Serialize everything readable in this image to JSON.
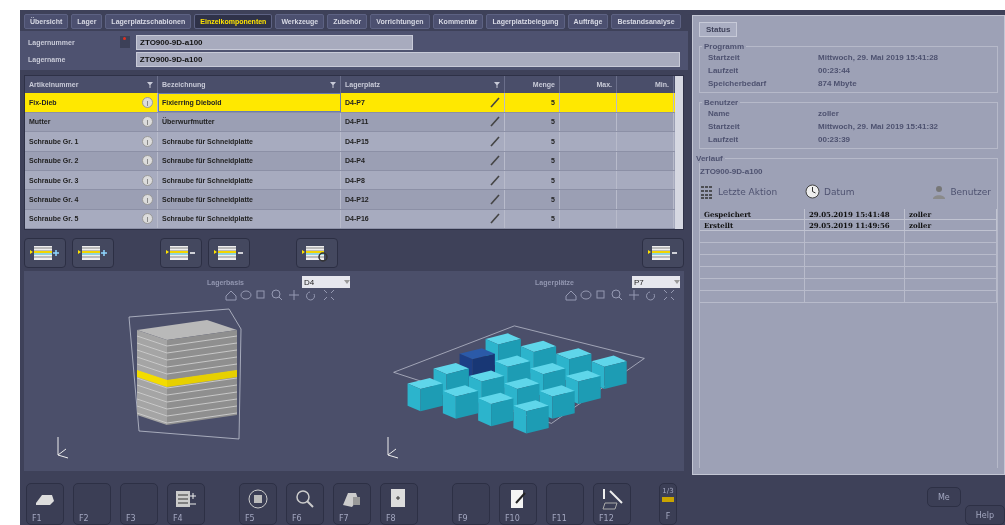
{
  "tabs": [
    {
      "label": "Übersicht",
      "selected": false
    },
    {
      "label": "Lager",
      "selected": false
    },
    {
      "label": "Lagerplatzschablonen",
      "selected": false
    },
    {
      "label": "Einzelkomponenten",
      "selected": true
    },
    {
      "label": "Werkzeuge",
      "selected": false
    },
    {
      "label": "Zubehör",
      "selected": false
    },
    {
      "label": "Vorrichtungen",
      "selected": false
    },
    {
      "label": "Kommentar",
      "selected": false
    },
    {
      "label": "Lagerplatzbelegung",
      "selected": false
    },
    {
      "label": "Aufträge",
      "selected": false
    },
    {
      "label": "Bestandsanalyse",
      "selected": false
    }
  ],
  "fields": [
    {
      "label": "Lagernummer",
      "value": "ZTO900-9D-a100",
      "required": true
    },
    {
      "label": "Lagername",
      "value": "ZTO900-9D-a100",
      "required": false
    }
  ],
  "table": {
    "columns": [
      {
        "label": "Artikelnummer",
        "filter": true
      },
      {
        "label": "Bezeichnung",
        "filter": true
      },
      {
        "label": "Lagerplatz",
        "filter": true
      },
      {
        "label": "Menge",
        "filter": false
      },
      {
        "label": "Max.",
        "filter": false
      },
      {
        "label": "Min.",
        "filter": false
      }
    ],
    "rows": [
      {
        "artikelnummer": "Fix-Dieb",
        "bezeichnung": "Fixierring Diebold",
        "lagerplatz": "D4-P7",
        "menge": "5",
        "selected": true
      },
      {
        "artikelnummer": "Mutter",
        "bezeichnung": "Überwurfmutter",
        "lagerplatz": "D4-P11",
        "menge": "5",
        "selected": false
      },
      {
        "artikelnummer": "Schraube Gr. 1",
        "bezeichnung": "Schraube für Schneidplatte",
        "lagerplatz": "D4-P15",
        "menge": "5",
        "selected": false
      },
      {
        "artikelnummer": "Schraube Gr. 2",
        "bezeichnung": "Schraube für Schneidplatte",
        "lagerplatz": "D4-P4",
        "menge": "5",
        "selected": false
      },
      {
        "artikelnummer": "Schraube Gr. 3",
        "bezeichnung": "Schraube für Schneidplatte",
        "lagerplatz": "D4-P8",
        "menge": "5",
        "selected": false
      },
      {
        "artikelnummer": "Schraube Gr. 4",
        "bezeichnung": "Schraube für Schneidplatte",
        "lagerplatz": "D4-P12",
        "menge": "5",
        "selected": false
      },
      {
        "artikelnummer": "Schraube Gr. 5",
        "bezeichnung": "Schraube für Schneidplatte",
        "lagerplatz": "D4-P16",
        "menge": "5",
        "selected": false
      }
    ]
  },
  "table_toolbar": [
    {
      "kind": "add"
    },
    {
      "kind": "add"
    },
    {
      "kind": "gap"
    },
    {
      "kind": "remove"
    },
    {
      "kind": "remove"
    },
    {
      "kind": "gap"
    },
    {
      "kind": "search"
    },
    {
      "kind": "spacer"
    },
    {
      "kind": "remove"
    }
  ],
  "viewers": [
    {
      "title": "Lagerbasis",
      "selector": "D4",
      "kind": "stack"
    },
    {
      "title": "Lagerplätze",
      "selector": "P7",
      "kind": "grid"
    }
  ],
  "status": {
    "tab": "Status",
    "sections": [
      {
        "title": "Programm",
        "rows": [
          {
            "label": "Startzeit",
            "value": "Mittwoch, 29. Mai 2019 15:41:28"
          },
          {
            "label": "Laufzeit",
            "value": "00:23:44"
          },
          {
            "label": "Speicherbedarf",
            "value": "874 Mbyte"
          }
        ]
      },
      {
        "title": "Benutzer",
        "rows": [
          {
            "label": "Name",
            "value": "zoller"
          },
          {
            "label": "Startzeit",
            "value": "Mittwoch, 29. Mai 2019 15:41:32"
          },
          {
            "label": "Laufzeit",
            "value": "00:23:39"
          }
        ]
      }
    ],
    "history": {
      "title": "Verlauf",
      "subtitle": "ZTO900-9D-a100",
      "columns": [
        {
          "label": "Letzte Aktion"
        },
        {
          "label": "Datum"
        },
        {
          "label": "Benutzer"
        }
      ],
      "rows": [
        [
          "Gespeichert",
          "29.05.2019 15:41:48",
          "zoller"
        ],
        [
          "Erstellt",
          "29.05.2019 11:49:56",
          "zoller"
        ]
      ]
    }
  },
  "function_keys": [
    {
      "label": "F1",
      "kind": "tray"
    },
    {
      "label": "F2",
      "kind": "empty"
    },
    {
      "label": "F3",
      "kind": "empty"
    },
    {
      "label": "F4",
      "kind": "grid"
    },
    {
      "label": "F5",
      "kind": "rotate"
    },
    {
      "label": "F6",
      "kind": "zoom"
    },
    {
      "label": "F7",
      "kind": "parts"
    },
    {
      "label": "F8",
      "kind": "doc"
    },
    {
      "label": "F9",
      "kind": "empty"
    },
    {
      "label": "F10",
      "kind": "edit"
    },
    {
      "label": "F11",
      "kind": "empty"
    },
    {
      "label": "F12",
      "kind": "tools"
    }
  ],
  "page_key": {
    "label": "F",
    "page": "1/3"
  },
  "side_buttons": [
    {
      "label": "Me"
    },
    {
      "label": "Help"
    }
  ]
}
